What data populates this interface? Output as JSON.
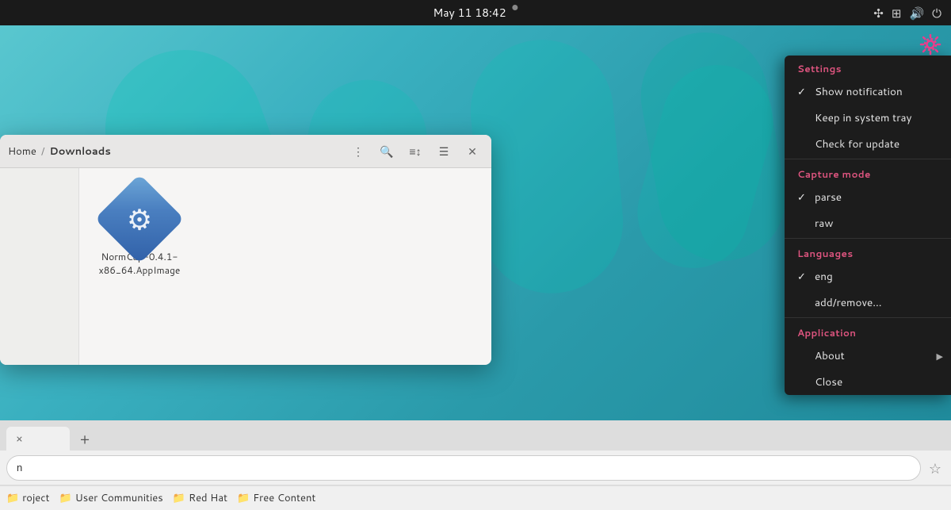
{
  "topbar": {
    "datetime": "May 11  18:42",
    "dot": "●"
  },
  "file_manager": {
    "breadcrumb_home": "Home",
    "breadcrumb_sep": "/",
    "breadcrumb_current": "Downloads",
    "file": {
      "name": "NormCap-0.4.1-x86_64.AppImage"
    }
  },
  "context_menu": {
    "settings_title": "Settings",
    "show_notification": "Show notification",
    "keep_in_system_tray": "Keep in system tray",
    "check_for_update": "Check for update",
    "capture_mode_title": "Capture mode",
    "parse": "parse",
    "raw": "raw",
    "languages_title": "Languages",
    "eng": "eng",
    "add_remove": "add/remove...",
    "application_title": "Application",
    "about": "About",
    "close": "Close"
  },
  "browser": {
    "tab_close_symbol": "×",
    "tab_new_symbol": "+",
    "url_placeholder": "n",
    "star_symbol": "☆",
    "bookmarks": [
      {
        "label": "roject",
        "type": "folder"
      },
      {
        "label": "User Communities",
        "type": "folder"
      },
      {
        "label": "Red Hat",
        "type": "folder"
      },
      {
        "label": "Free Content",
        "type": "folder"
      }
    ]
  }
}
